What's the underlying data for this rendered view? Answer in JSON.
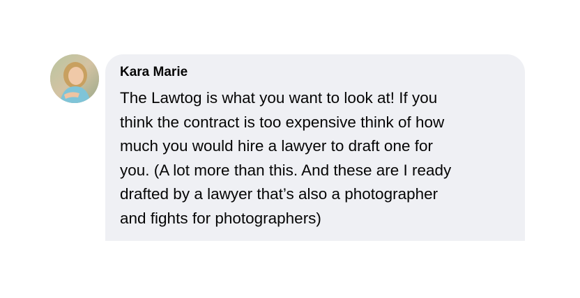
{
  "comment": {
    "author": "Kara Marie",
    "avatar_icon": "profile-photo",
    "lines": [
      "The Lawtog is what you want to look at! If you",
      "think the contract is too expensive think of how",
      "much you would hire a lawyer to draft one for",
      "you. (A lot more than this. And these are I ready",
      "drafted by a lawyer that’s also a photographer",
      "and fights for photographers)"
    ]
  },
  "colors": {
    "bubble_background": "#eff0f4",
    "text": "#050505",
    "page_background": "#ffffff"
  }
}
